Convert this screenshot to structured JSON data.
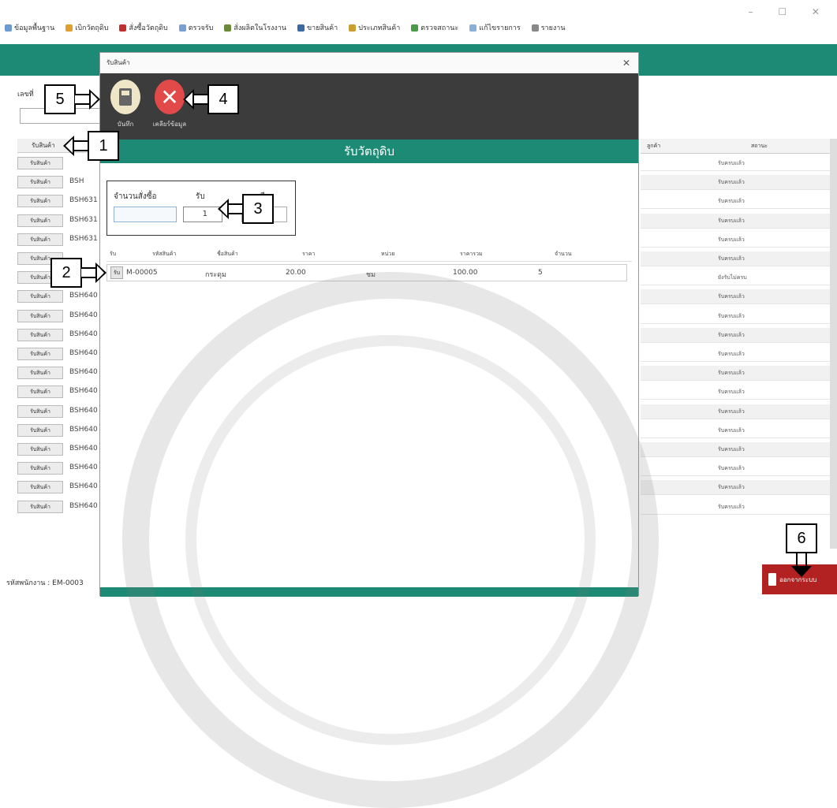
{
  "window_controls": "– ☐ ✕",
  "menu": [
    {
      "label": "ข้อมูลพื้นฐาน",
      "color": "#6c9bd2"
    },
    {
      "label": "เบิกวัตถุดิบ",
      "color": "#e0a030"
    },
    {
      "label": "สั่งซื้อวัตถุดิบ",
      "color": "#c03030"
    },
    {
      "label": "ตรวจรับ",
      "color": "#7aa0d0"
    },
    {
      "label": "สั่งผลิตในโรงงาน",
      "color": "#6a8a3a"
    },
    {
      "label": "ขายสินค้า",
      "color": "#3a6aa0"
    },
    {
      "label": "ประเภทสินค้า",
      "color": "#c8a030"
    },
    {
      "label": "ตรวจสถานะ",
      "color": "#4a9a4a"
    },
    {
      "label": "แก้ไขรายการ",
      "color": "#8ab0d8"
    },
    {
      "label": "รายงาน",
      "color": "#888888"
    }
  ],
  "background": {
    "label": "เลขที่",
    "grid_header": "รับสินค้า",
    "right_header_left": "ลูกค้า",
    "right_header_right": "สถานะ",
    "row_button": "รับสินค้า",
    "rows": [
      {
        "code": "",
        "status": "รับครบแล้ว"
      },
      {
        "code": "BSH",
        "status": "รับครบแล้ว"
      },
      {
        "code": "BSH631",
        "status": "รับครบแล้ว"
      },
      {
        "code": "BSH631",
        "status": "รับครบแล้ว"
      },
      {
        "code": "BSH631",
        "status": "รับครบแล้ว"
      },
      {
        "code": "",
        "status": "รับครบแล้ว"
      },
      {
        "code": "BSH640",
        "status": "ยังรับไม่ครบ"
      },
      {
        "code": "BSH640",
        "status": "รับครบแล้ว"
      },
      {
        "code": "BSH640",
        "status": "รับครบแล้ว"
      },
      {
        "code": "BSH640",
        "status": "รับครบแล้ว"
      },
      {
        "code": "BSH640",
        "status": "รับครบแล้ว"
      },
      {
        "code": "BSH640",
        "status": "รับครบแล้ว"
      },
      {
        "code": "BSH640",
        "status": "รับครบแล้ว"
      },
      {
        "code": "BSH640",
        "status": "รับครบแล้ว"
      },
      {
        "code": "BSH640",
        "status": "รับครบแล้ว"
      },
      {
        "code": "BSH640",
        "status": "รับครบแล้ว"
      },
      {
        "code": "BSH640",
        "status": "รับครบแล้ว"
      },
      {
        "code": "BSH640",
        "status": "รับครบแล้ว"
      },
      {
        "code": "BSH640",
        "status": "รับครบแล้ว"
      }
    ],
    "employee_label": "รหัสพนักงาน : EM-0003",
    "logout_label": "ออกจากระบบ"
  },
  "modal": {
    "title": "รับสินค้า",
    "close": "✕",
    "save_label": "บันทึก",
    "clear_label": "เคลียร์ข้อมูล",
    "clear_glyph": "✕",
    "heading": "รับวัตถุดิบ",
    "qty_labels": {
      "ordered": "จำนวนสั่งซื้อ",
      "receive": "รับ",
      "remain": "คงเหลือ"
    },
    "qty_receive_value": "1",
    "table_headers": [
      "รับ",
      "รหัสสินค้า",
      "ชื่อสินค้า",
      "ราคา",
      "หน่วย",
      "ราคารวม",
      "จำนวน"
    ],
    "row": {
      "btn": "รับ",
      "code": "M-00005",
      "name": "กระดุม",
      "price": "20.00",
      "unit": "ชม",
      "total": "100.00",
      "qty": "5"
    }
  },
  "callouts": [
    "1",
    "2",
    "3",
    "4",
    "5",
    "6"
  ]
}
